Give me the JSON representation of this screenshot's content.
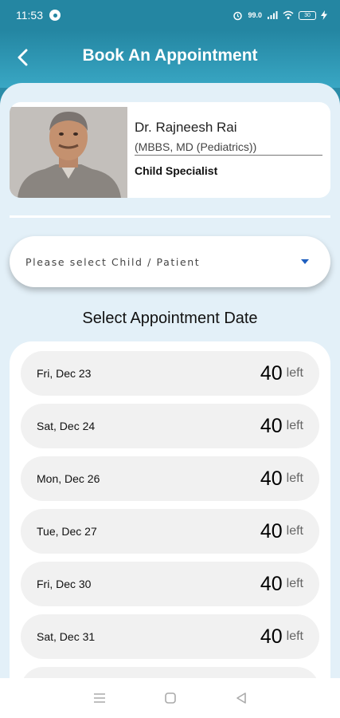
{
  "status_bar": {
    "time": "11:53",
    "network_speed": "99.0",
    "battery": "30"
  },
  "header": {
    "title": "Book An Appointment",
    "back_icon": "chevron-left-icon"
  },
  "doctor": {
    "name": "Dr. Rajneesh Rai",
    "degree": "(MBBS, MD (Pediatrics))",
    "specialty": "Child Specialist"
  },
  "patient_select": {
    "placeholder": "Please select Child / Patient",
    "icon": "caret-down-icon",
    "accent": "#1f5fbf"
  },
  "section_title": "Select Appointment Date",
  "dates": [
    {
      "label": "Fri, Dec 23",
      "count": "40",
      "suffix": "left"
    },
    {
      "label": "Sat, Dec 24",
      "count": "40",
      "suffix": "left"
    },
    {
      "label": "Mon, Dec 26",
      "count": "40",
      "suffix": "left"
    },
    {
      "label": "Tue, Dec 27",
      "count": "40",
      "suffix": "left"
    },
    {
      "label": "Fri, Dec 30",
      "count": "40",
      "suffix": "left"
    },
    {
      "label": "Sat, Dec 31",
      "count": "40",
      "suffix": "left"
    }
  ],
  "colors": {
    "header": "#2486a2",
    "background": "#e3f0f8"
  }
}
